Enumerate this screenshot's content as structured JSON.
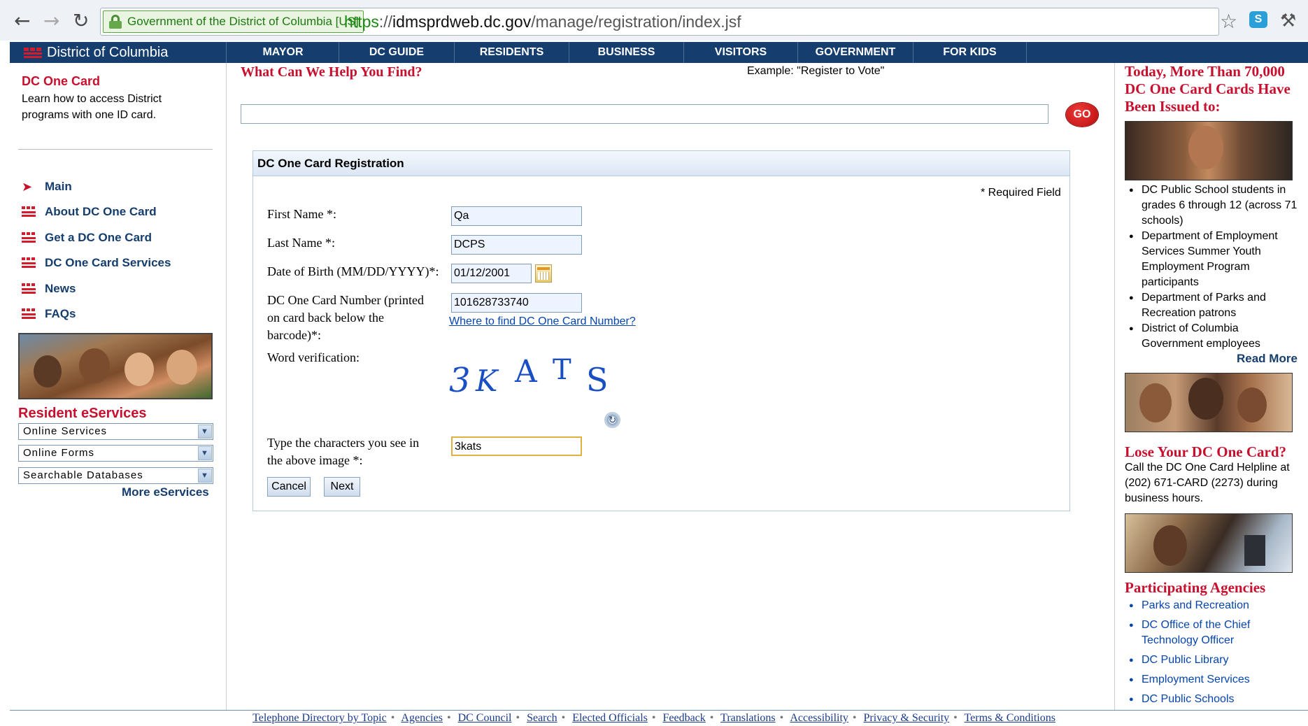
{
  "browser": {
    "ev_label": "Government of the District of Columbia [US]",
    "url_scheme": "https",
    "url_sep": "://",
    "url_host": "idmsprdweb.dc.gov",
    "url_path": "/manage/registration/index.jsf"
  },
  "topnav": {
    "brand": "District of Columbia",
    "items": [
      "MAYOR",
      "DC GUIDE",
      "RESIDENTS",
      "BUSINESS",
      "VISITORS",
      "GOVERNMENT",
      "FOR KIDS"
    ]
  },
  "left": {
    "title": "DC One Card",
    "desc": "Learn how to access District programs with one ID card.",
    "nav": [
      "Main",
      "About DC One Card",
      "Get a DC One Card",
      "DC One Card Services",
      "News",
      "FAQs"
    ],
    "eservices_title": "Resident eServices",
    "dropdowns": [
      "Online Services",
      "Online Forms",
      "Searchable Databases"
    ],
    "more_eservices": "More eServices"
  },
  "search": {
    "title": "What Can We Help You Find?",
    "example": "Example: \"Register to Vote\"",
    "value": "",
    "go": "GO"
  },
  "form": {
    "heading": "DC One Card Registration",
    "required_note": "* Required Field",
    "first_name_label": "First Name *:",
    "first_name_value": "Qa",
    "last_name_label": "Last Name *:",
    "last_name_value": "DCPS",
    "dob_label": "Date of Birth (MM/DD/YYYY)*:",
    "dob_value": "01/12/2001",
    "card_label_1": "DC One Card Number (printed",
    "card_label_2": "on card back below the",
    "card_label_3": "barcode)*:",
    "card_value": "101628733740",
    "card_help_link": "Where to find DC One Card Number?",
    "word_label": "Word verification:",
    "captcha_chars": [
      "3",
      "K",
      "A",
      "T",
      "S"
    ],
    "type_label_1": "Type the characters you see in",
    "type_label_2": "the above image *:",
    "type_value": "3kats",
    "cancel": "Cancel",
    "next": "Next"
  },
  "right": {
    "headline": "Today, More Than 70,000 DC One Card Cards Have Been Issued to:",
    "issued_list": [
      "DC Public School students in grades 6 through 12 (across 71 schools)",
      "Department of Employment Services Summer Youth Employment Program participants",
      "Department of Parks and Recreation patrons",
      "District of Columbia Government employees"
    ],
    "read_more": "Read More",
    "lose_title": "Lose Your DC One Card?",
    "lose_text": "Call the DC One Card Helpline at (202) 671-CARD (2273) during business hours.",
    "agencies_title": "Participating Agencies",
    "agencies": [
      "Parks and Recreation",
      "DC Office of the Chief Technology Officer",
      "DC Public Library",
      "Employment Services",
      "DC Public Schools"
    ]
  },
  "footer": {
    "links": [
      "Telephone Directory by Topic",
      "Agencies",
      "DC Council",
      "Search",
      "Elected Officials",
      "Feedback",
      "Translations",
      "Accessibility",
      "Privacy & Security",
      "Terms & Conditions"
    ]
  },
  "colors": {
    "nav_blue": "#153d6e",
    "accent_red": "#c8102e",
    "link_blue": "#0645ad"
  }
}
